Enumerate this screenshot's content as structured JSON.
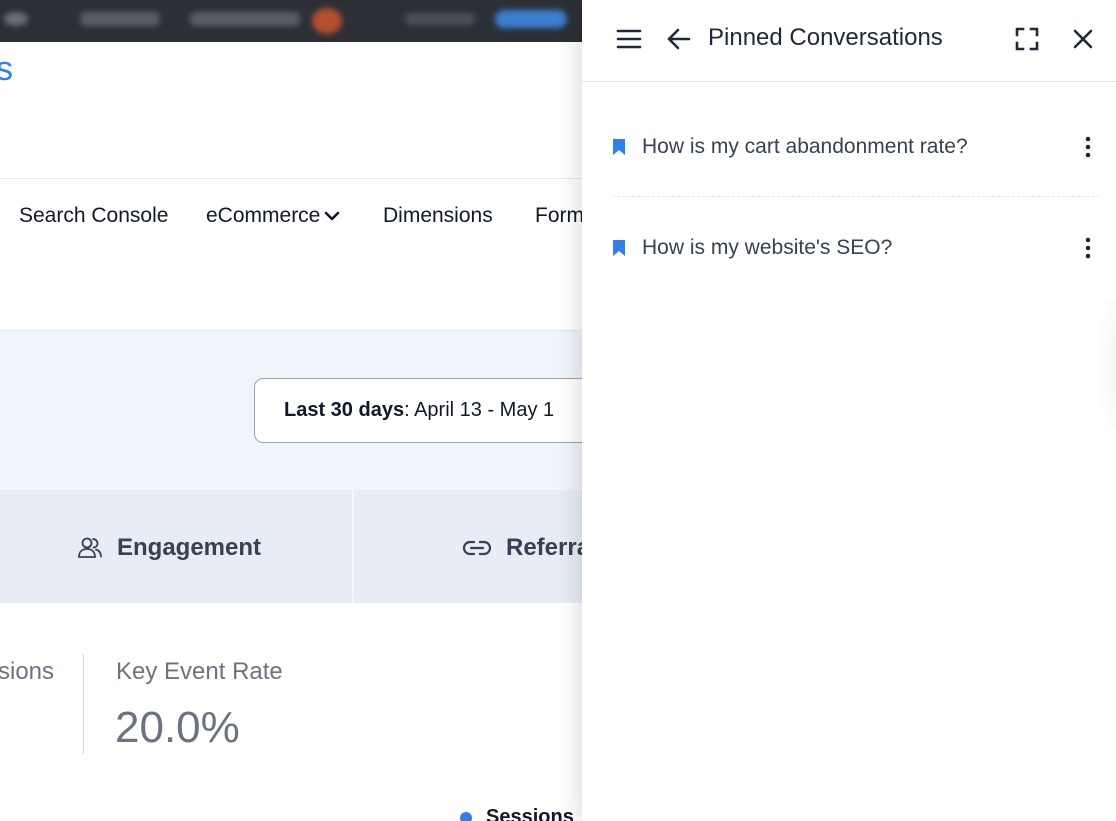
{
  "background": {
    "brand_fragment": "s",
    "nav": {
      "items": [
        {
          "label": "Search Console"
        },
        {
          "label": "eCommerce"
        },
        {
          "label": "Dimensions"
        },
        {
          "label": "Form"
        }
      ]
    },
    "date_range": {
      "prefix": "Last 30 days",
      "range": ": April 13 - May 1"
    },
    "tabs": [
      {
        "label": "Engagement",
        "icon": "users-icon"
      },
      {
        "label": "Referra",
        "icon": "link-icon"
      }
    ],
    "metrics": [
      {
        "label": "sions",
        "value": ""
      },
      {
        "label": "Key Event Rate",
        "value": "20.0%"
      }
    ],
    "legend": {
      "label": "Sessions",
      "color": "#2f80ed"
    }
  },
  "panel": {
    "title": "Pinned Conversations",
    "conversations": [
      {
        "text": "How is my cart abandonment rate?",
        "icon": "bookmark-icon"
      },
      {
        "text": "How is my website's SEO?",
        "icon": "bookmark-icon"
      }
    ]
  },
  "colors": {
    "accent": "#2f80ed",
    "admin_bar": "#2c3036",
    "date_band": "#f0f4fb",
    "tabs_band": "#e8edf5"
  }
}
